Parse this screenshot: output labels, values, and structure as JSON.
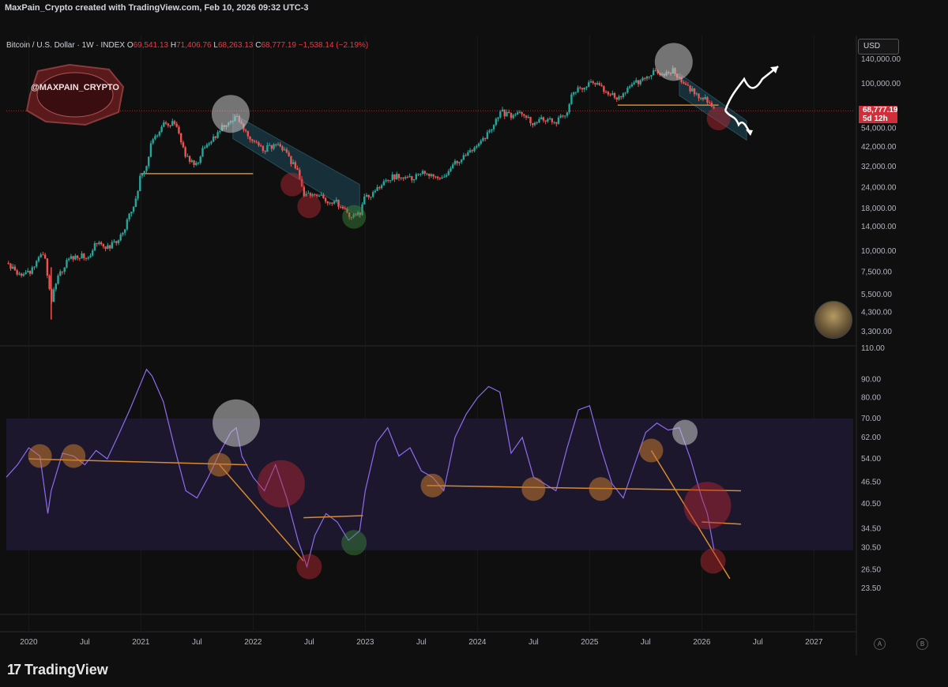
{
  "credit": "MaxPain_Crypto created with TradingView.com, Feb 10, 2026 09:32 UTC-3",
  "symbol": {
    "name": "Bitcoin / U.S. Dollar · 1W · INDEX",
    "o_label": "O",
    "o": "69,541.13",
    "h_label": "H",
    "h": "71,406.76",
    "l_label": "L",
    "l": "68,263.13",
    "c_label": "C",
    "c": "68,777.19",
    "change": "−1,538.14 (−2.19%)"
  },
  "currency": "USD",
  "price_tag": {
    "price": "68,777.19",
    "countdown": "5d 12h"
  },
  "watermark_text": "@MAXPAIN_CRYPTO",
  "brand": {
    "logo": "17",
    "name": "TradingView"
  },
  "axis_buttons": {
    "a": "A",
    "b": "B"
  },
  "colors": {
    "up": "#26a69a",
    "down": "#ef5350",
    "rsi": "#8e6cf0",
    "trend": "#d88a2d",
    "channel": "#1f4a5a",
    "band": "#1e1830"
  },
  "chart_data": [
    {
      "type": "candlestick",
      "title": "Bitcoin / U.S. Dollar · 1W · INDEX",
      "scale": "log",
      "ylim": [
        3300,
        140000
      ],
      "y_ticks": [
        "140,000.00",
        "100,000.00",
        "54,000.00",
        "42,000.00",
        "32,000.00",
        "24,000.00",
        "18,000.00",
        "14,000.00",
        "10,000.00",
        "7,500.00",
        "5,500.00",
        "4,300.00",
        "3,300.00"
      ],
      "y_tick_values": [
        140000,
        100000,
        54000,
        42000,
        32000,
        24000,
        18000,
        14000,
        10000,
        7500,
        5500,
        4300,
        3300
      ],
      "x_ticks": [
        "2020",
        "Jul",
        "2021",
        "Jul",
        "2022",
        "Jul",
        "2023",
        "Jul",
        "2024",
        "Jul",
        "2025",
        "Jul",
        "2026",
        "Jul",
        "2027"
      ],
      "x_tick_values": [
        2020.0,
        2020.5,
        2021.0,
        2021.5,
        2022.0,
        2022.5,
        2023.0,
        2023.5,
        2024.0,
        2024.5,
        2025.0,
        2025.5,
        2026.0,
        2026.5,
        2027.0
      ],
      "last_price": 68777.19,
      "path": [
        [
          2019.8,
          8500
        ],
        [
          2019.9,
          7200
        ],
        [
          2020.0,
          7300
        ],
        [
          2020.1,
          9500
        ],
        [
          2020.15,
          8800
        ],
        [
          2020.2,
          5000
        ],
        [
          2020.25,
          6800
        ],
        [
          2020.35,
          9000
        ],
        [
          2020.45,
          9400
        ],
        [
          2020.55,
          9200
        ],
        [
          2020.6,
          11500
        ],
        [
          2020.7,
          10500
        ],
        [
          2020.8,
          11800
        ],
        [
          2020.85,
          13500
        ],
        [
          2020.9,
          17500
        ],
        [
          2020.95,
          19200
        ],
        [
          2021.0,
          29000
        ],
        [
          2021.05,
          33000
        ],
        [
          2021.1,
          46000
        ],
        [
          2021.15,
          50000
        ],
        [
          2021.2,
          57000
        ],
        [
          2021.3,
          58000
        ],
        [
          2021.35,
          48000
        ],
        [
          2021.4,
          36000
        ],
        [
          2021.5,
          33000
        ],
        [
          2021.55,
          40000
        ],
        [
          2021.65,
          47000
        ],
        [
          2021.75,
          58000
        ],
        [
          2021.85,
          63000
        ],
        [
          2021.9,
          56000
        ],
        [
          2022.0,
          46000
        ],
        [
          2022.1,
          40000
        ],
        [
          2022.2,
          44000
        ],
        [
          2022.3,
          38000
        ],
        [
          2022.4,
          29000
        ],
        [
          2022.45,
          21000
        ],
        [
          2022.55,
          22000
        ],
        [
          2022.65,
          20000
        ],
        [
          2022.75,
          19500
        ],
        [
          2022.85,
          16500
        ],
        [
          2022.95,
          16800
        ],
        [
          2023.0,
          21000
        ],
        [
          2023.1,
          23000
        ],
        [
          2023.2,
          27000
        ],
        [
          2023.3,
          28500
        ],
        [
          2023.4,
          27000
        ],
        [
          2023.5,
          30000
        ],
        [
          2023.6,
          29000
        ],
        [
          2023.7,
          26500
        ],
        [
          2023.8,
          34000
        ],
        [
          2023.9,
          37000
        ],
        [
          2024.0,
          43000
        ],
        [
          2024.1,
          51000
        ],
        [
          2024.2,
          68000
        ],
        [
          2024.3,
          64000
        ],
        [
          2024.4,
          68000
        ],
        [
          2024.5,
          58000
        ],
        [
          2024.6,
          62000
        ],
        [
          2024.7,
          60000
        ],
        [
          2024.8,
          69000
        ],
        [
          2024.85,
          90000
        ],
        [
          2024.95,
          98000
        ],
        [
          2025.05,
          102000
        ],
        [
          2025.15,
          88000
        ],
        [
          2025.25,
          82000
        ],
        [
          2025.35,
          95000
        ],
        [
          2025.45,
          105000
        ],
        [
          2025.55,
          118000
        ],
        [
          2025.65,
          113000
        ],
        [
          2025.75,
          120000
        ],
        [
          2025.8,
          108000
        ],
        [
          2025.85,
          96000
        ],
        [
          2025.95,
          88000
        ],
        [
          2026.05,
          78000
        ],
        [
          2026.11,
          68777
        ]
      ],
      "horizontal_levels": [
        {
          "x": [
            2021.0,
            2022.0
          ],
          "y": 29000
        },
        {
          "x": [
            2025.25,
            2026.15
          ],
          "y": 74500
        }
      ],
      "channels": [
        {
          "upper": [
            [
              2021.82,
              66000
            ],
            [
              2022.95,
              25000
            ]
          ],
          "lower": [
            [
              2021.82,
              47000
            ],
            [
              2022.95,
              16000
            ]
          ]
        },
        {
          "upper": [
            [
              2025.8,
              115000
            ],
            [
              2026.4,
              60000
            ]
          ],
          "lower": [
            [
              2025.8,
              85000
            ],
            [
              2026.4,
              46000
            ]
          ]
        }
      ],
      "circles": [
        {
          "x": 2021.8,
          "y": 66000,
          "size": "large",
          "color": "gray"
        },
        {
          "x": 2022.35,
          "y": 25000,
          "size": "medium",
          "color": "red"
        },
        {
          "x": 2022.5,
          "y": 18500,
          "size": "medium",
          "color": "red"
        },
        {
          "x": 2022.9,
          "y": 16000,
          "size": "medium",
          "color": "green"
        },
        {
          "x": 2025.75,
          "y": 135000,
          "size": "large",
          "color": "gray"
        },
        {
          "x": 2026.15,
          "y": 62000,
          "size": "medium",
          "color": "red"
        }
      ]
    },
    {
      "type": "line",
      "ylim": [
        23.5,
        110
      ],
      "y_ticks": [
        "110.00",
        "90.00",
        "80.00",
        "70.00",
        "62.00",
        "54.00",
        "46.50",
        "40.50",
        "34.50",
        "30.50",
        "26.50",
        "23.50"
      ],
      "y_tick_values": [
        110,
        90,
        80,
        70,
        62,
        54,
        46.5,
        40.5,
        34.5,
        30.5,
        26.5,
        23.5
      ],
      "band": [
        30,
        70
      ],
      "series": [
        {
          "x": [
            2019.8,
            2019.9,
            2020.0,
            2020.1,
            2020.17,
            2020.2,
            2020.3,
            2020.4,
            2020.5,
            2020.6,
            2020.7,
            2020.8,
            2020.9,
            2021.0,
            2021.05,
            2021.1,
            2021.2,
            2021.3,
            2021.4,
            2021.5,
            2021.6,
            2021.7,
            2021.8,
            2021.85,
            2021.9,
            2022.0,
            2022.1,
            2022.2,
            2022.3,
            2022.4,
            2022.48,
            2022.55,
            2022.65,
            2022.75,
            2022.85,
            2022.95,
            2023.0,
            2023.1,
            2023.2,
            2023.3,
            2023.4,
            2023.5,
            2023.6,
            2023.7,
            2023.8,
            2023.9,
            2024.0,
            2024.1,
            2024.2,
            2024.3,
            2024.4,
            2024.5,
            2024.6,
            2024.7,
            2024.8,
            2024.9,
            2025.0,
            2025.1,
            2025.2,
            2025.3,
            2025.4,
            2025.5,
            2025.6,
            2025.7,
            2025.8,
            2025.9,
            2026.0,
            2026.05,
            2026.11
          ],
          "values": [
            48,
            52,
            58,
            55,
            38,
            44,
            56,
            55,
            52,
            57,
            54,
            63,
            74,
            88,
            96,
            92,
            78,
            58,
            44,
            42,
            48,
            56,
            64,
            66,
            55,
            48,
            44,
            52,
            42,
            32,
            27,
            33,
            38,
            36,
            32,
            34,
            44,
            60,
            66,
            55,
            58,
            50,
            48,
            44,
            62,
            72,
            80,
            86,
            83,
            56,
            62,
            48,
            46,
            44,
            58,
            74,
            76,
            58,
            46,
            42,
            52,
            64,
            68,
            65,
            66,
            54,
            42,
            38,
            30
          ]
        }
      ],
      "trendlines": [
        [
          [
            2020.0,
            54
          ],
          [
            2021.95,
            52
          ]
        ],
        [
          [
            2021.7,
            52
          ],
          [
            2022.45,
            28
          ]
        ],
        [
          [
            2022.45,
            37
          ],
          [
            2022.98,
            37.5
          ]
        ],
        [
          [
            2023.55,
            45.5
          ],
          [
            2026.35,
            44
          ]
        ],
        [
          [
            2025.55,
            57
          ],
          [
            2026.25,
            25
          ]
        ],
        [
          [
            2026.0,
            36
          ],
          [
            2026.35,
            35.5
          ]
        ]
      ],
      "circles": [
        {
          "x": 2020.1,
          "y": 55,
          "size": "small",
          "color": "orange"
        },
        {
          "x": 2020.4,
          "y": 55,
          "size": "small",
          "color": "orange"
        },
        {
          "x": 2021.7,
          "y": 52,
          "size": "small",
          "color": "orange"
        },
        {
          "x": 2021.85,
          "y": 68,
          "size": "large",
          "color": "gray"
        },
        {
          "x": 2022.25,
          "y": 46,
          "size": "large",
          "color": "red"
        },
        {
          "x": 2022.5,
          "y": 27,
          "size": "medium",
          "color": "red"
        },
        {
          "x": 2022.9,
          "y": 31.5,
          "size": "medium",
          "color": "green"
        },
        {
          "x": 2023.6,
          "y": 45.5,
          "size": "small",
          "color": "orange"
        },
        {
          "x": 2024.5,
          "y": 44.5,
          "size": "small",
          "color": "orange"
        },
        {
          "x": 2025.1,
          "y": 44.5,
          "size": "small",
          "color": "orange"
        },
        {
          "x": 2025.55,
          "y": 57,
          "size": "small",
          "color": "orange"
        },
        {
          "x": 2025.85,
          "y": 64,
          "size": "medium",
          "color": "gray"
        },
        {
          "x": 2026.05,
          "y": 40,
          "size": "large",
          "color": "red"
        },
        {
          "x": 2026.1,
          "y": 28,
          "size": "medium",
          "color": "red"
        }
      ]
    }
  ]
}
